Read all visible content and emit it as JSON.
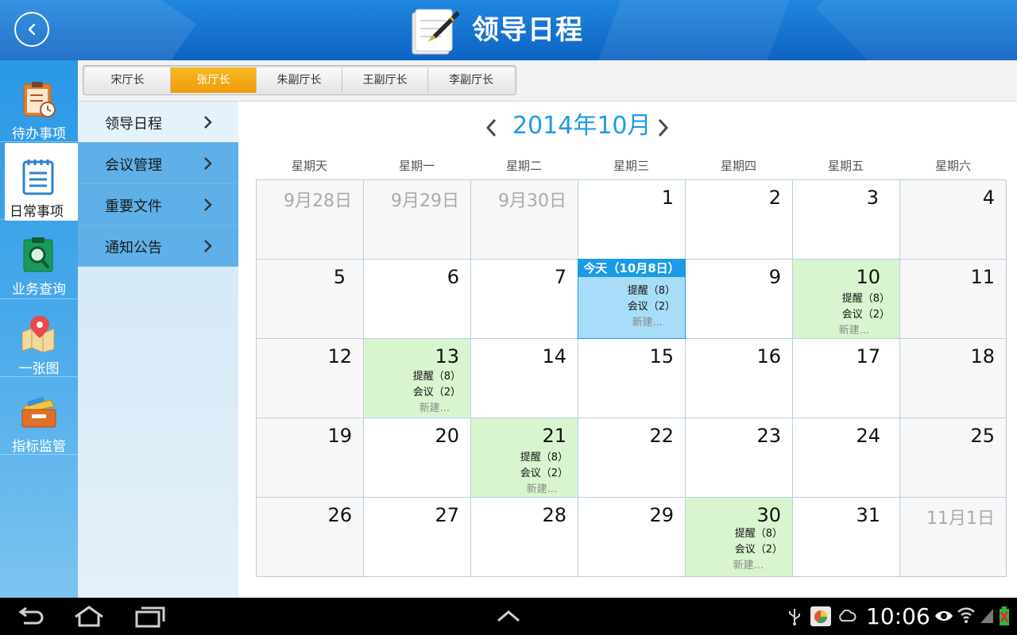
{
  "header": {
    "title": "领导日程"
  },
  "left_nav": {
    "items": [
      {
        "label": "待办事项",
        "icon": "todo-clipboard-icon"
      },
      {
        "label": "日常事项",
        "icon": "notepad-icon"
      },
      {
        "label": "业务查询",
        "icon": "search-clipboard-icon"
      },
      {
        "label": "一张图",
        "icon": "map-pin-icon"
      },
      {
        "label": "指标监管",
        "icon": "drawer-icon"
      }
    ],
    "active_index": 1
  },
  "tabs": {
    "items": [
      "宋厅长",
      "张厅长",
      "朱副厅长",
      "王副厅长",
      "李副厅长"
    ],
    "active_index": 1
  },
  "sub_menu": {
    "items": [
      "领导日程",
      "会议管理",
      "重要文件",
      "通知公告"
    ],
    "active_index": 0
  },
  "calendar": {
    "month_title": "2014年10月",
    "weekdays": [
      "星期天",
      "星期一",
      "星期二",
      "星期三",
      "星期四",
      "星期五",
      "星期六"
    ],
    "today_label": "今天（10月8日）",
    "event_texts": {
      "reminder": "提醒（8）",
      "meeting": "会议（2）",
      "new": "新建..."
    },
    "weeks": [
      [
        "9月28日",
        "9月29日",
        "9月30日",
        "1",
        "2",
        "3",
        "4"
      ],
      [
        "5",
        "6",
        "7",
        "",
        "9",
        "10",
        "11"
      ],
      [
        "12",
        "13",
        "14",
        "15",
        "16",
        "17",
        "18"
      ],
      [
        "19",
        "20",
        "21",
        "22",
        "23",
        "24",
        "25"
      ],
      [
        "26",
        "27",
        "28",
        "29",
        "30",
        "31",
        "11月1日"
      ]
    ]
  },
  "status_bar": {
    "time": "10:06"
  },
  "colors": {
    "accent_blue": "#1d9be3",
    "tab_active": "#f2a714",
    "event_green": "#d9f5cf",
    "today_blue": "#a7ddf8"
  }
}
